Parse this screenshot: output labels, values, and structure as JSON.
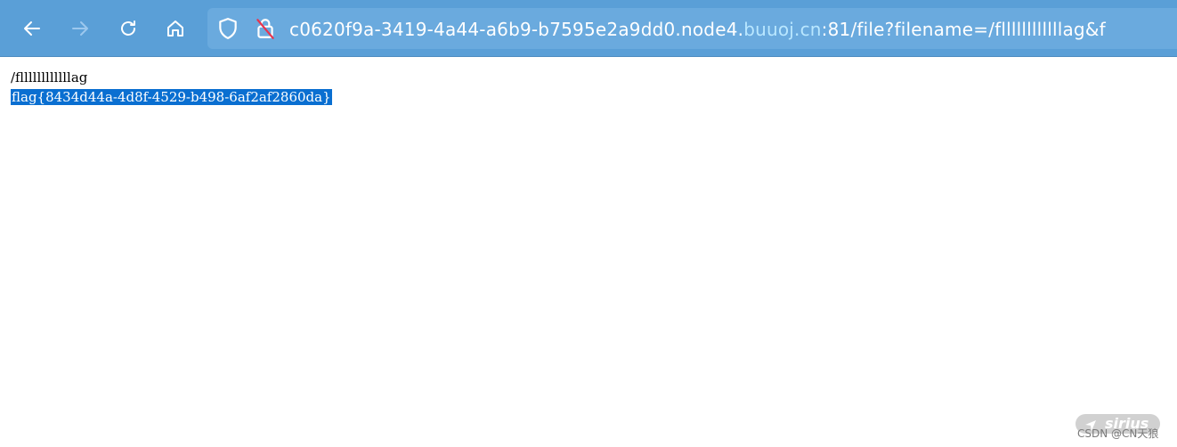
{
  "browser": {
    "url_prefix": "c0620f9a-3419-4a44-a6b9-b7595e2a9dd0.node4.",
    "url_domain": "buuoj.cn",
    "url_suffix": ":81/file?filename=/fllllllllllllag&f",
    "icons": {
      "back": "arrow-left-icon",
      "forward": "arrow-right-icon",
      "reload": "reload-icon",
      "home": "home-icon",
      "shield": "shield-icon",
      "lock": "lock-slash-icon"
    },
    "colors": {
      "toolbar": "#5a9fd7",
      "urlbar": "#6aaade",
      "domain_highlight": "#b9e7ff"
    }
  },
  "page": {
    "line1": "/fllllllllllllag",
    "line2": "flag{8434d44a-4d8f-4529-b498-6af2af2860da}",
    "selection_color": "#0a6fd1"
  },
  "watermark": {
    "logo_text": "sirius",
    "credit": "CSDN @CN天狼"
  }
}
